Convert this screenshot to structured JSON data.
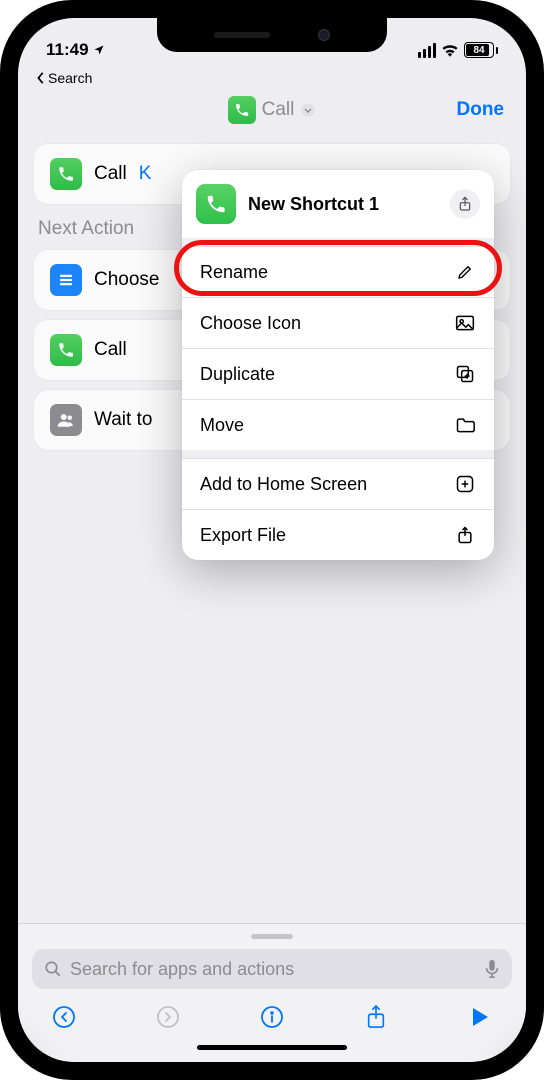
{
  "status_bar": {
    "time": "11:49",
    "battery": "84"
  },
  "back_link": "Search",
  "nav": {
    "title": "Call",
    "done": "Done"
  },
  "action_card": {
    "label": "Call",
    "hint": "K"
  },
  "section_header": "Next Action",
  "suggestions": [
    {
      "label": "Choose"
    },
    {
      "label": "Call"
    },
    {
      "label": "Wait to"
    }
  ],
  "popover": {
    "title": "New Shortcut 1",
    "items": {
      "rename": "Rename",
      "choose_icon": "Choose Icon",
      "duplicate": "Duplicate",
      "move": "Move",
      "add_home": "Add to Home Screen",
      "export": "Export File"
    }
  },
  "search": {
    "placeholder": "Search for apps and actions"
  }
}
